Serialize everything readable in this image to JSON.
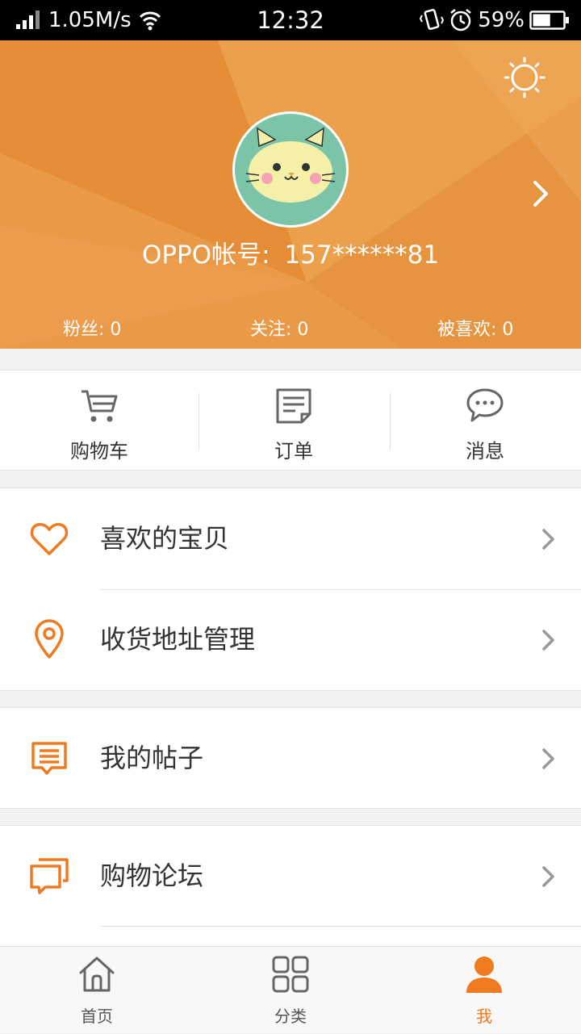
{
  "status_bar": {
    "speed": "1.05M/s",
    "time": "12:32",
    "battery": "59%",
    "battery_level": 0.59
  },
  "header": {
    "account_label": "OPPO帐号:",
    "account_number": "157******81",
    "stats": [
      {
        "label": "粉丝:",
        "value": "0"
      },
      {
        "label": "关注:",
        "value": "0"
      },
      {
        "label": "被喜欢:",
        "value": "0"
      }
    ]
  },
  "quick_actions": [
    {
      "label": "购物车",
      "icon": "cart-icon"
    },
    {
      "label": "订单",
      "icon": "order-icon"
    },
    {
      "label": "消息",
      "icon": "message-icon"
    }
  ],
  "menu": {
    "favorites": {
      "label": "喜欢的宝贝",
      "icon": "heart-icon"
    },
    "address": {
      "label": "收货地址管理",
      "icon": "location-pin-icon"
    },
    "posts": {
      "label": "我的帖子",
      "icon": "post-icon"
    },
    "forum": {
      "label": "购物论坛",
      "icon": "forum-icon"
    }
  },
  "bottom_nav": [
    {
      "label": "首页",
      "icon": "home-icon",
      "active": false
    },
    {
      "label": "分类",
      "icon": "category-icon",
      "active": false
    },
    {
      "label": "我",
      "icon": "profile-icon",
      "active": true
    }
  ],
  "colors": {
    "accent": "#f07a1f",
    "header_bg": "#e99a46",
    "avatar_bg": "#7cc4a8"
  }
}
